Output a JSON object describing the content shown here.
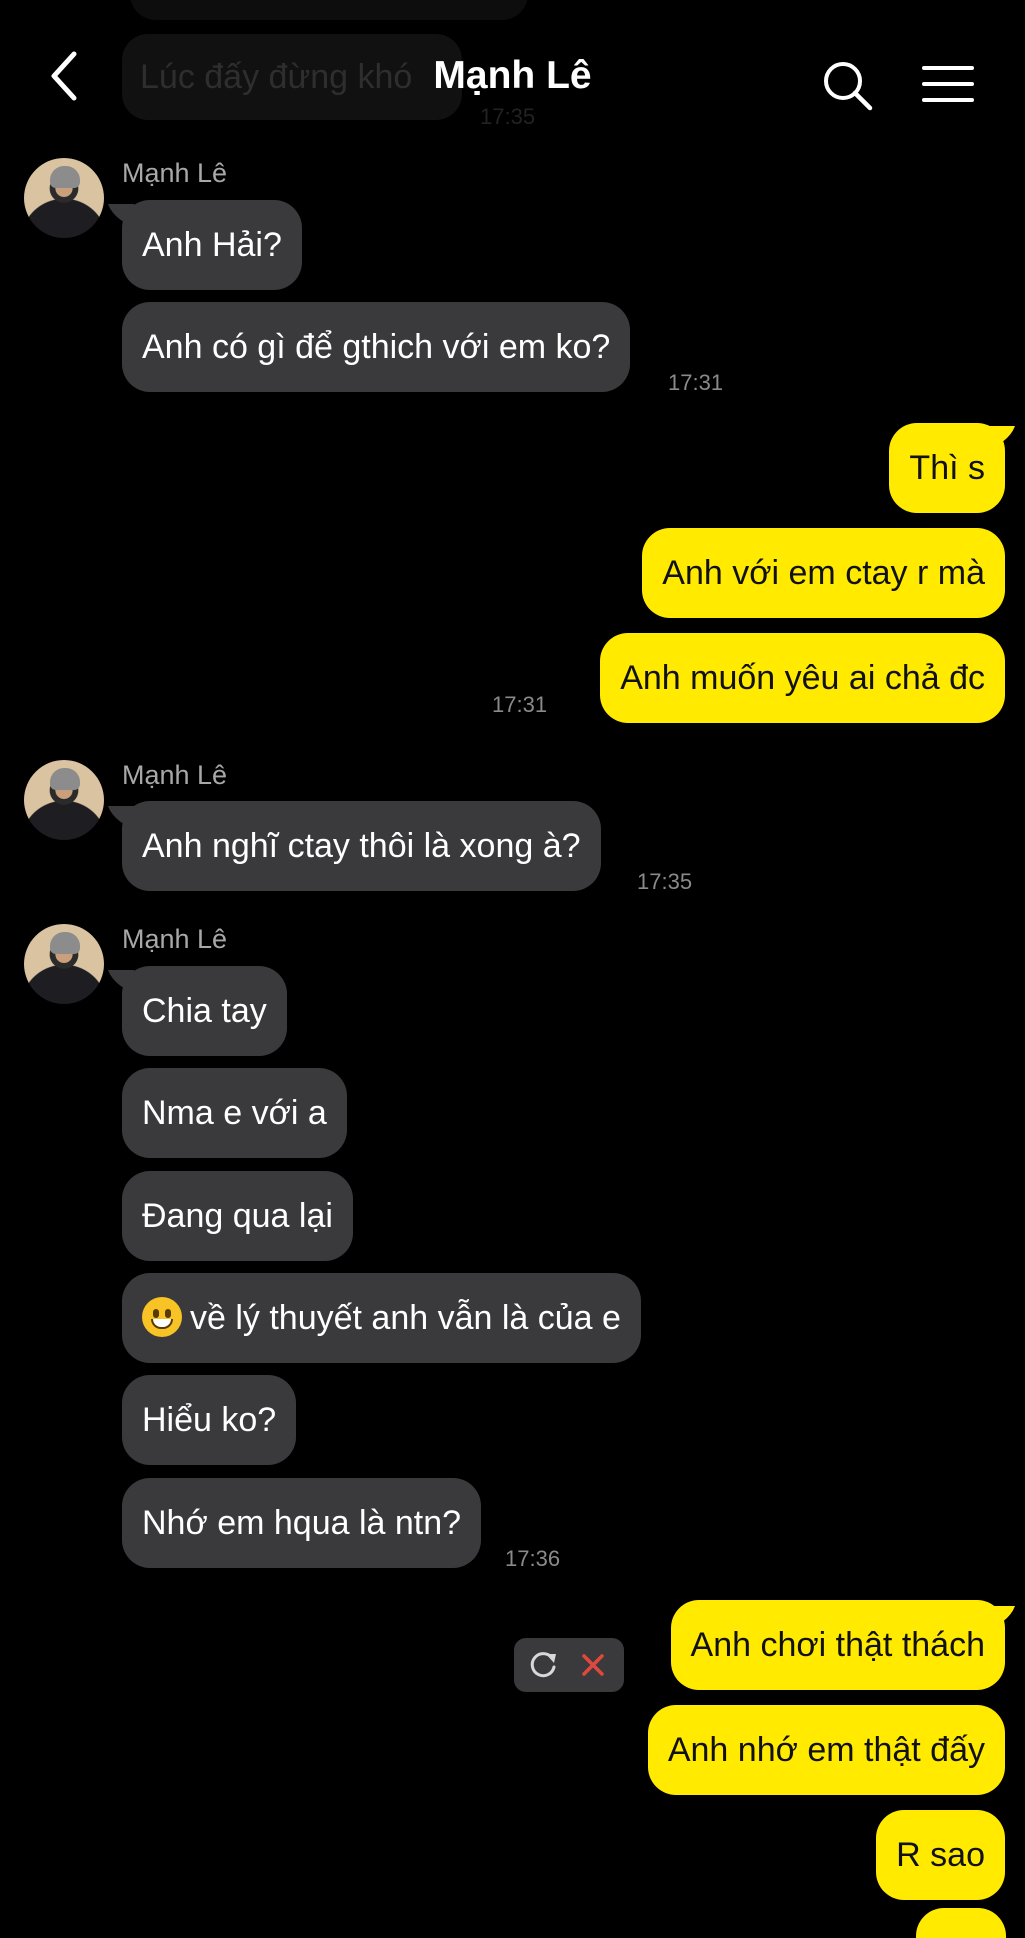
{
  "header": {
    "title": "Mạnh Lê",
    "ghost_message": "Lúc đấy đừng khó",
    "ghost_time": "17:35"
  },
  "contact": {
    "name": "Mạnh Lê"
  },
  "messages": {
    "g1_sender": "Mạnh Lê",
    "m1": "Anh Hải?",
    "m2": "Anh có gì để gthich với em ko?",
    "t1": "17:31",
    "m3": "Thì s",
    "m4": "Anh với em ctay r mà",
    "m5": "Anh muốn yêu ai chả đc",
    "t2": "17:31",
    "g2_sender": "Mạnh Lê",
    "m6": "Anh nghĩ ctay thôi là xong à?",
    "t3": "17:35",
    "g3_sender": "Mạnh Lê",
    "m7": "Chia tay",
    "m8": "Nma e với a",
    "m9": "Đang qua lại",
    "m10": "về lý thuyết anh vẫn là của e",
    "m11": "Hiểu ko?",
    "m12": "Nhớ em hqua là ntn?",
    "t4": "17:36",
    "m13": "Anh chơi thật thách",
    "m14": "Anh nhớ em thật đấy",
    "m15": "R sao"
  },
  "icons": {
    "back": "chevron-left-icon",
    "search": "search-icon",
    "menu": "hamburger-menu-icon",
    "retry": "retry-icon",
    "cancel": "close-icon",
    "emoji": "grinning-face-emoji"
  },
  "colors": {
    "background": "#000000",
    "incoming_bubble": "#3a3a3c",
    "outgoing_bubble": "#ffea00",
    "cancel_red": "#e0483e"
  }
}
